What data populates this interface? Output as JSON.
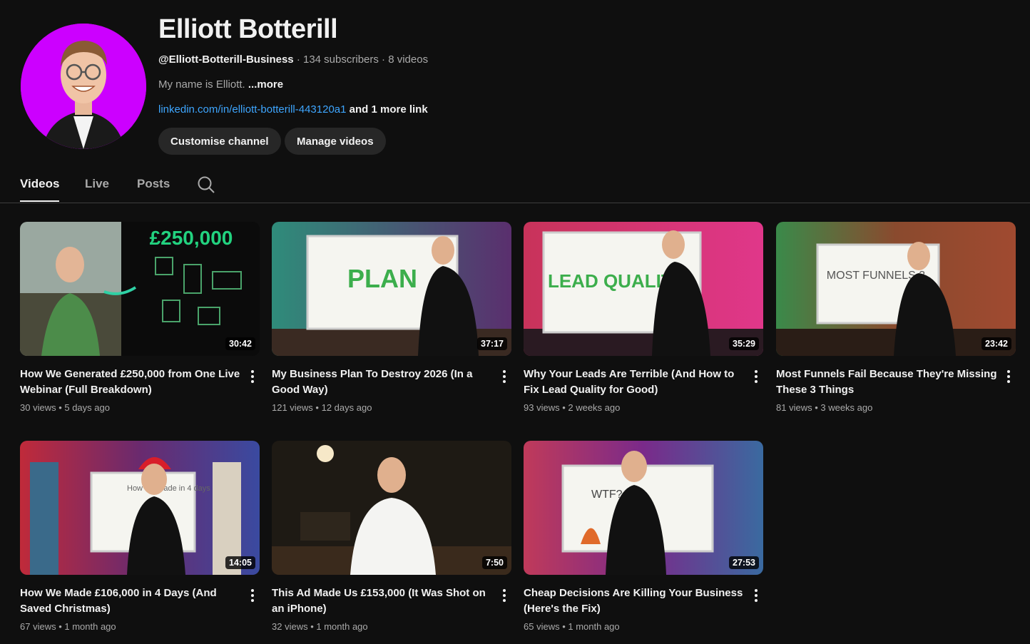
{
  "channel": {
    "name": "Elliott Botterill",
    "handle": "@Elliott-Botterill-Business",
    "subscribers": "134 subscribers",
    "videos_count": "8 videos",
    "separator": "·",
    "description": "My name is Elliott.",
    "description_more": "...more",
    "link": "linkedin.com/in/elliott-botterill-443120a1",
    "more_links": "and 1 more link",
    "avatar_bg": "#cc00ff"
  },
  "actions": {
    "customise": "Customise channel",
    "manage": "Manage videos"
  },
  "tabs": [
    "Videos",
    "Live",
    "Posts"
  ],
  "active_tab": "Videos",
  "videos": [
    {
      "title": "How We Generated £250,000 from One Live Webinar (Full Breakdown)",
      "views": "30 views",
      "age": "5 days ago",
      "duration": "30:42",
      "thumb_text": "£250,000"
    },
    {
      "title": "My Business Plan To Destroy 2026 (In a Good Way)",
      "views": "121 views",
      "age": "12 days ago",
      "duration": "37:17",
      "thumb_text": "PLAN"
    },
    {
      "title": "Why Your Leads Are Terrible (And How to Fix Lead Quality for Good)",
      "views": "93 views",
      "age": "2 weeks ago",
      "duration": "35:29",
      "thumb_text": "LEAD QUALITY"
    },
    {
      "title": "Most Funnels Fail Because They're Missing These 3 Things",
      "views": "81 views",
      "age": "3 weeks ago",
      "duration": "23:42",
      "thumb_text": "MOST FUNNELS 3"
    },
    {
      "title": "How We Made £106,000 in 4 Days (And Saved Christmas)",
      "views": "67 views",
      "age": "1 month ago",
      "duration": "14:05",
      "thumb_text": "How we made in 4 days"
    },
    {
      "title": "This Ad Made Us £153,000 (It Was Shot on an iPhone)",
      "views": "32 views",
      "age": "1 month ago",
      "duration": "7:50",
      "thumb_text": ""
    },
    {
      "title": "Cheap Decisions Are Killing Your Business (Here's the Fix)",
      "views": "65 views",
      "age": "1 month ago",
      "duration": "27:53",
      "thumb_text": "WTF?"
    }
  ],
  "colors": {
    "link": "#3ea6ff",
    "background": "#0f0f0f",
    "button": "#272727"
  }
}
